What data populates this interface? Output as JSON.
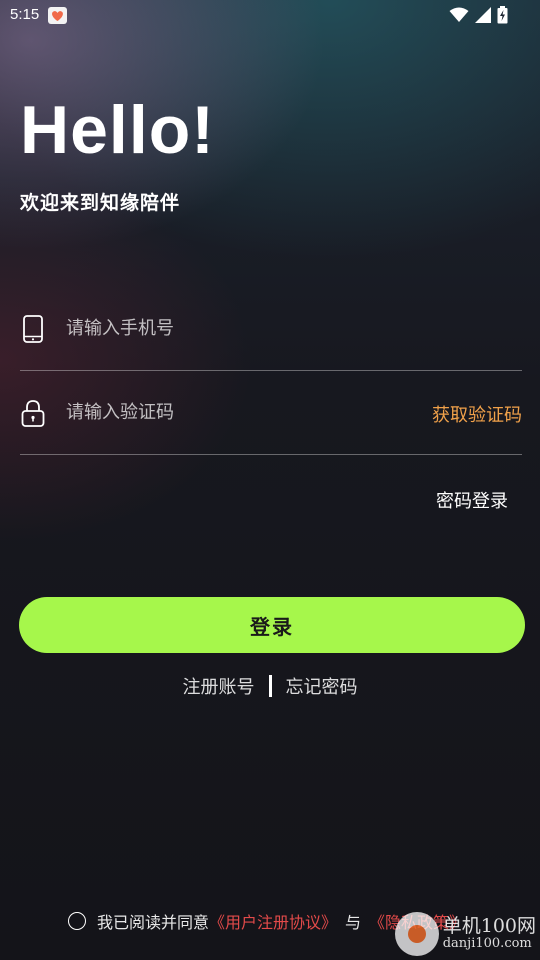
{
  "status_bar": {
    "time": "5:15",
    "notification_icon": "app-heart-icon",
    "icons": [
      "wifi-icon",
      "signal-icon",
      "battery-charging-icon"
    ]
  },
  "hero": {
    "title": "Hello!",
    "subtitle": "欢迎来到知缘陪伴"
  },
  "form": {
    "phone": {
      "icon": "phone-icon",
      "placeholder": "请输入手机号",
      "value": ""
    },
    "code": {
      "icon": "lock-icon",
      "placeholder": "请输入验证码",
      "value": "",
      "get_code_label": "获取验证码"
    },
    "password_login_label": "密码登录",
    "login_button_label": "登录"
  },
  "links": {
    "register": "注册账号",
    "forgot_password": "忘记密码"
  },
  "agreement": {
    "checked": false,
    "prefix": "我已阅读并同意",
    "user_agreement": "《用户注册协议》",
    "conjunction": "与",
    "privacy_policy": "《隐私政策》"
  },
  "watermark": {
    "name": "单机100网",
    "url": "danji100.com"
  },
  "colors": {
    "accent": "#a6f74b",
    "get_code": "#f0a14a",
    "link_red": "#e24a4a",
    "background": "#141419"
  }
}
